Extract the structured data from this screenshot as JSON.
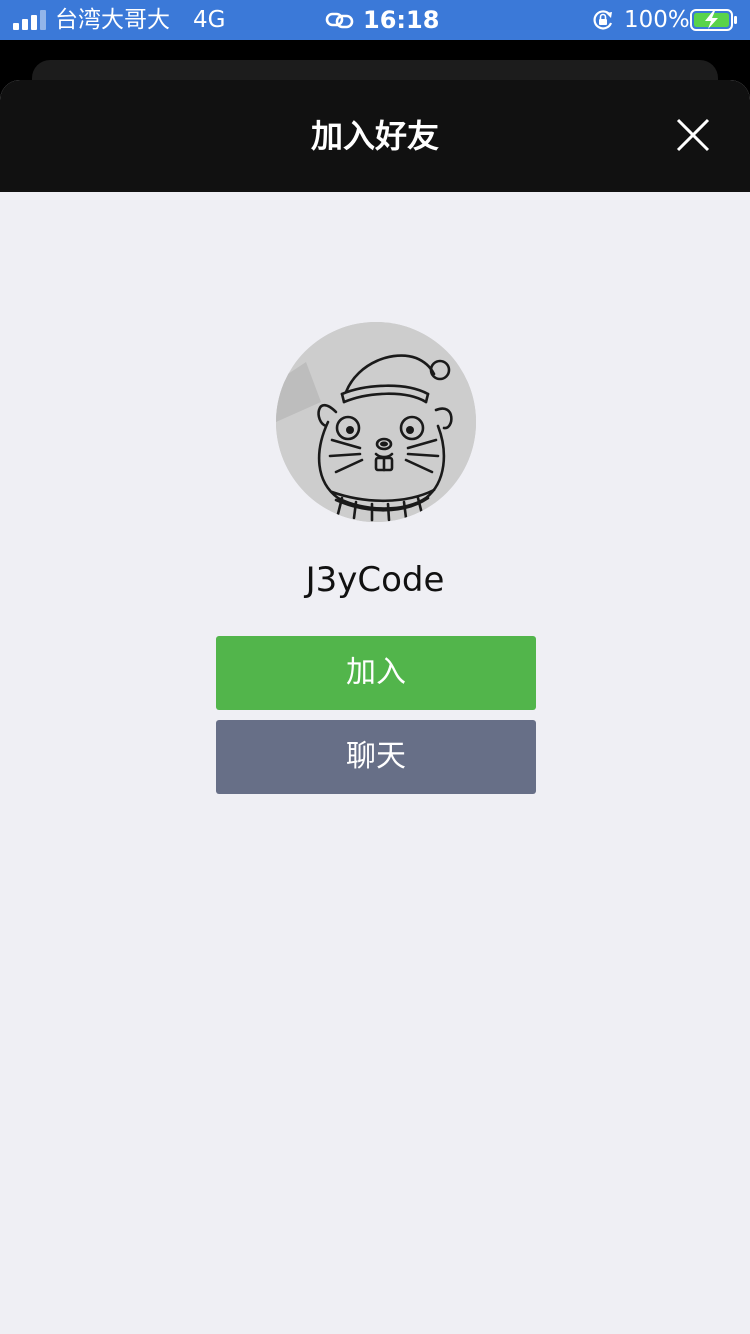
{
  "status_bar": {
    "carrier": "台湾大哥大",
    "network": "4G",
    "time": "16:18",
    "battery": "100%",
    "color": "#3b79d8"
  },
  "sheet": {
    "title": "加入好友",
    "close_icon": "close-icon"
  },
  "profile": {
    "avatar_icon": "hamster-drawing-avatar",
    "name": "J3yCode"
  },
  "actions": {
    "add_label": "加入",
    "add_color": "#52b54b",
    "chat_label": "聊天",
    "chat_color": "#676f87"
  }
}
